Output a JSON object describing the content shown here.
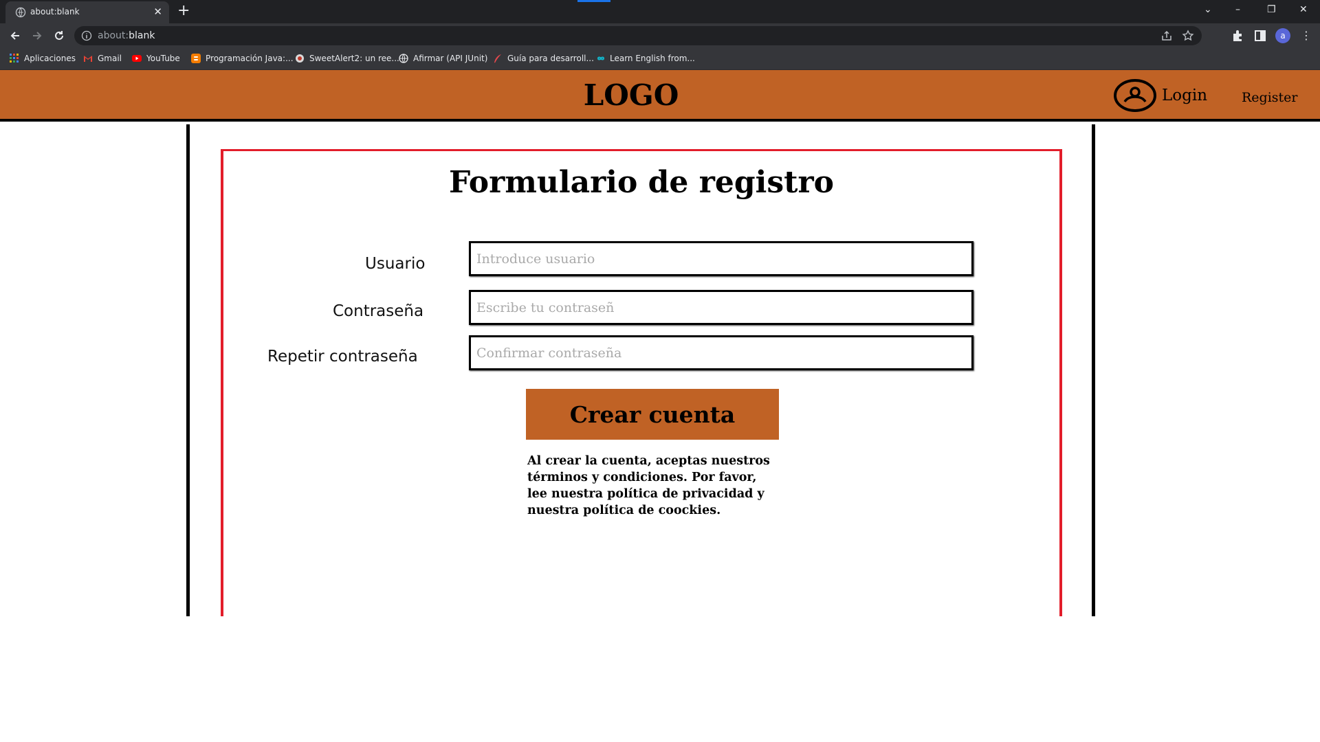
{
  "browser": {
    "tab_title": "about:blank",
    "url_scheme": "about:",
    "url_path": "blank",
    "avatar_letter": "a",
    "tab_indicator_color": "#1a73e8"
  },
  "bookmarks": [
    {
      "label": "Aplicaciones",
      "icon": "apps-grid-icon"
    },
    {
      "label": "Gmail",
      "icon": "gmail-icon"
    },
    {
      "label": "YouTube",
      "icon": "youtube-icon"
    },
    {
      "label": "Programación Java:...",
      "icon": "blogger-icon"
    },
    {
      "label": "SweetAlert2: un ree...",
      "icon": "sweetalert-icon"
    },
    {
      "label": "Afirmar (API JUnit)",
      "icon": "globe-icon"
    },
    {
      "label": "Guía para desarroll...",
      "icon": "feather-icon"
    },
    {
      "label": "Learn English from...",
      "icon": "infinity-icon"
    }
  ],
  "header": {
    "logo": "LOGO",
    "login": "Login",
    "register": "Register",
    "background_color": "#c06225"
  },
  "form": {
    "title": "Formulario de registro",
    "fields": [
      {
        "label": "Usuario",
        "placeholder": "Introduce usuario",
        "value": ""
      },
      {
        "label": "Contraseña",
        "placeholder": "Escribe tu contraseñ",
        "value": ""
      },
      {
        "label": "Repetir contraseña",
        "placeholder": "Confirmar contraseña",
        "value": ""
      }
    ],
    "submit": "Crear cuenta",
    "terms": "Al crear la cuenta, aceptas nuestros términos y condiciones. Por favor, lee nuestra política de privacidad y nuestra política de coockies.",
    "border_color": "#e21d2a",
    "button_color": "#c06225"
  }
}
